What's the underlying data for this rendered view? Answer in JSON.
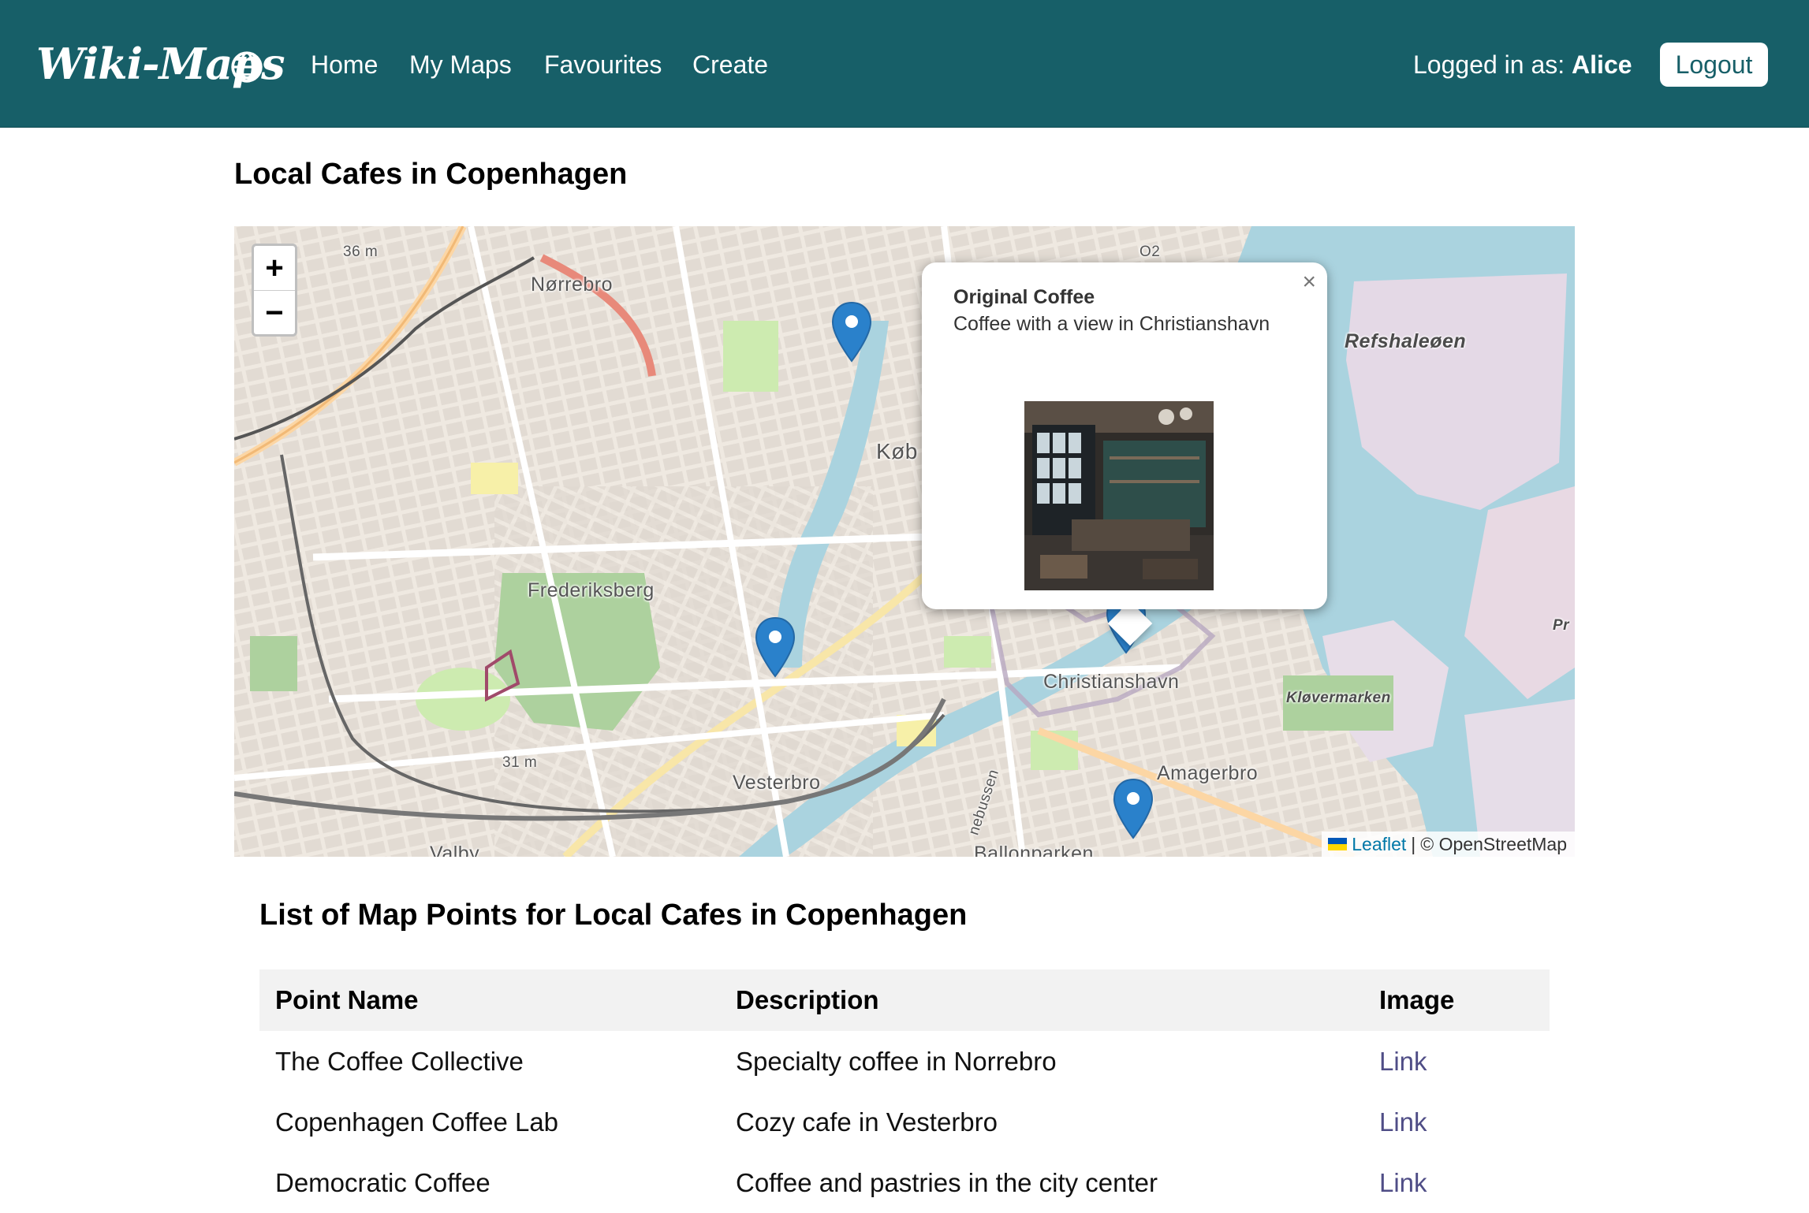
{
  "nav": {
    "brand": "Wiki-Maps",
    "links": [
      "Home",
      "My Maps",
      "Favourites",
      "Create"
    ],
    "login_prefix": "Logged in as: ",
    "user": "Alice",
    "logout": "Logout"
  },
  "map": {
    "title": "Local Cafes in Copenhagen",
    "zoom_in": "+",
    "zoom_out": "−",
    "places": [
      "Nørrebro",
      "Frederiksberg",
      "Vesterbro",
      "Christianshavn",
      "Amagerbro",
      "Refshaleøen",
      "Kløvermarken",
      "Køb",
      "Valby",
      "Ballonparken",
      "Pr",
      "36 m",
      "31 m",
      "O2",
      "nebussen"
    ],
    "attribution_leaflet": "Leaflet",
    "attribution_sep": " | ",
    "attribution_osm": "© OpenStreetMap",
    "popup": {
      "title": "Original Coffee",
      "description": "Coffee with a view in Christianshavn",
      "close": "×"
    }
  },
  "list": {
    "title": "List of Map Points for Local Cafes in Copenhagen",
    "headers": [
      "Point Name",
      "Description",
      "Image"
    ],
    "rows": [
      [
        "The Coffee Collective",
        "Specialty coffee in Norrebro",
        "Link"
      ],
      [
        "Copenhagen Coffee Lab",
        "Cozy cafe in Vesterbro",
        "Link"
      ],
      [
        "Democratic Coffee",
        "Coffee and pastries in the city center",
        "Link"
      ]
    ]
  },
  "colors": {
    "nav_bg": "#175f68",
    "marker": "#2a81cb",
    "link": "#4f4d86",
    "water": "#aad3df",
    "park": "#add19e"
  }
}
